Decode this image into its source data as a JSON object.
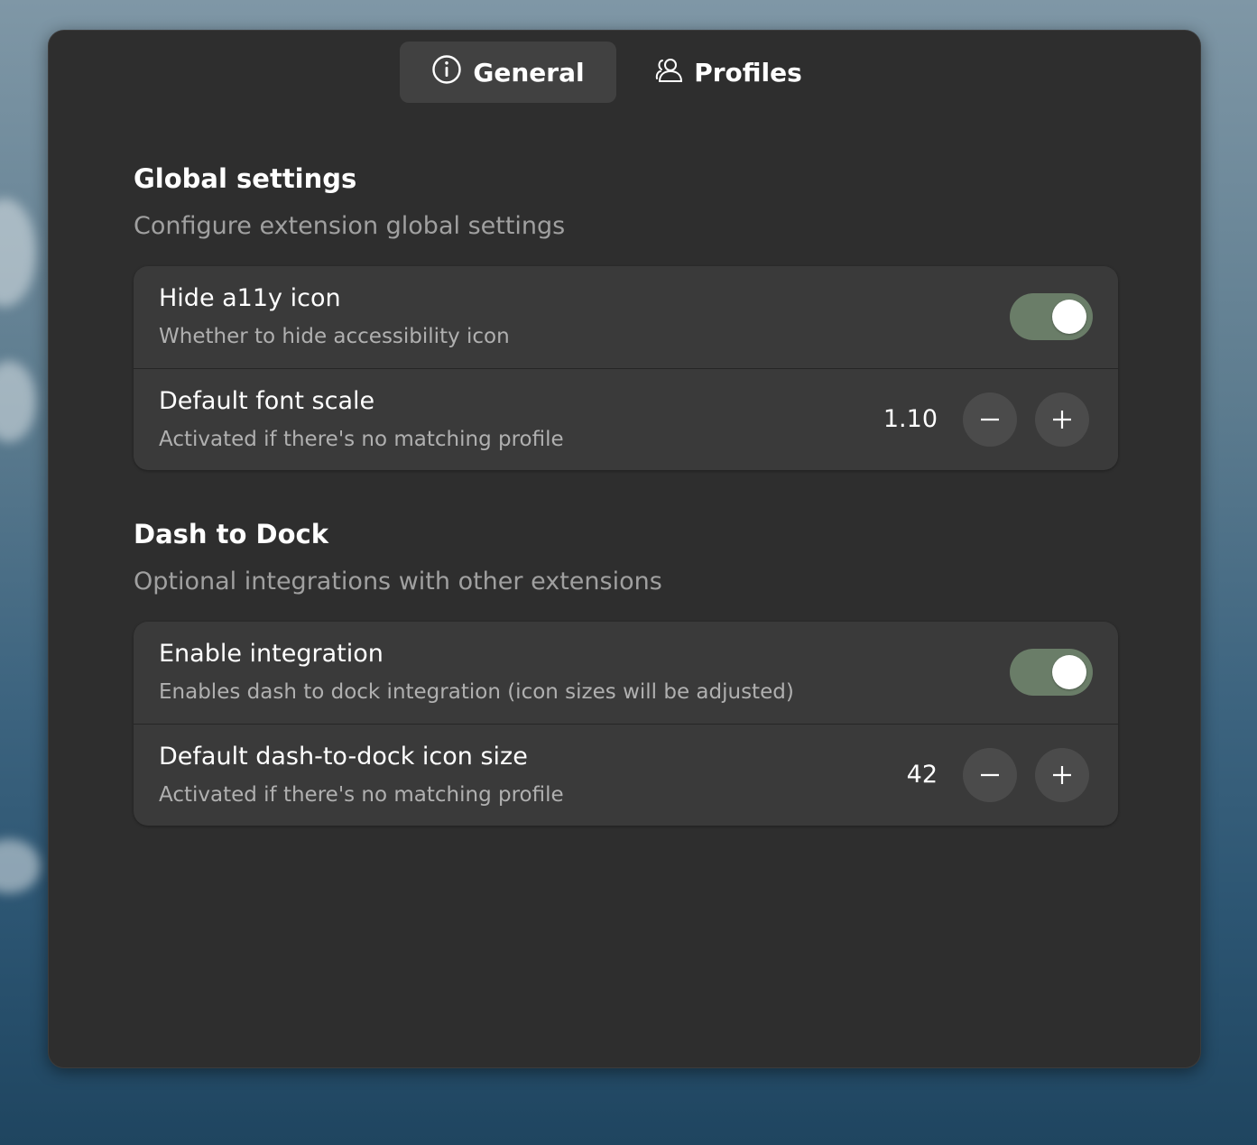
{
  "tabs": [
    {
      "label": "General",
      "icon": "info-icon",
      "active": true
    },
    {
      "label": "Profiles",
      "icon": "user-icon",
      "active": false
    }
  ],
  "global": {
    "title": "Global settings",
    "subtitle": "Configure extension global settings",
    "rows": {
      "hide_icon": {
        "title": "Hide a11y icon",
        "subtitle": "Whether to hide accessibility icon",
        "enabled": true
      },
      "font_scale": {
        "title": "Default font scale",
        "subtitle": "Activated if there's no matching profile",
        "value": "1.10"
      }
    }
  },
  "dock": {
    "title": "Dash to Dock",
    "subtitle": "Optional integrations with other extensions",
    "rows": {
      "enable": {
        "title": "Enable integration",
        "subtitle": "Enables dash to dock integration (icon sizes will be adjusted)",
        "enabled": true
      },
      "icon_size": {
        "title": "Default dash-to-dock icon size",
        "subtitle": "Activated if there's no matching profile",
        "value": "42"
      }
    }
  },
  "colors": {
    "window_bg": "#2e2e2e",
    "card_bg": "#3a3a3a",
    "switch_on": "#6a7d68",
    "button_bg": "#4b4b4b"
  }
}
